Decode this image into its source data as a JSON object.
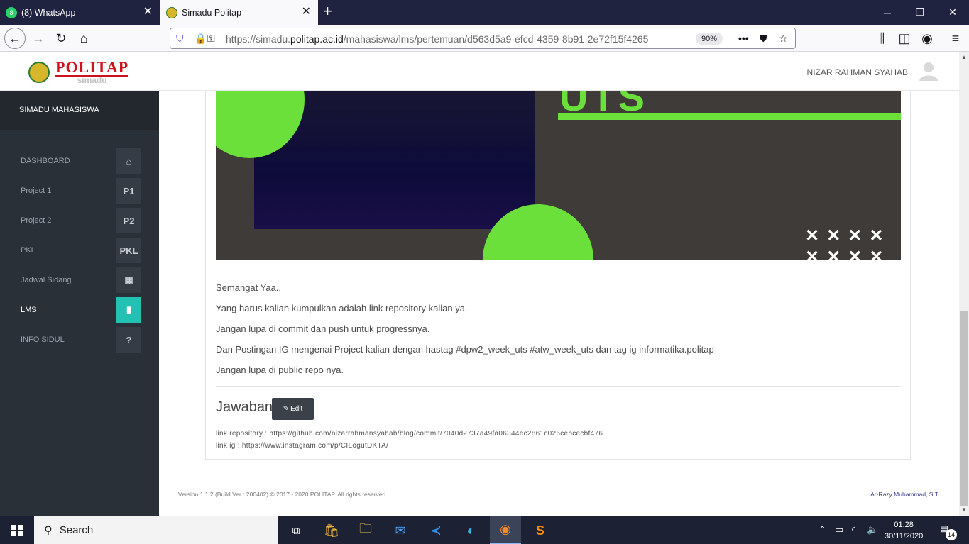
{
  "browser": {
    "tabs": [
      {
        "title": "(8) WhatsApp",
        "badge": "8",
        "active": false
      },
      {
        "title": "Simadu Politap",
        "active": true
      }
    ],
    "url_prefix": "https://simadu.",
    "url_domain": "politap.ac.id",
    "url_path": "/mahasiswa/lms/pertemuan/d563d5a9-efcd-4359-8b91-2e72f15f4265",
    "zoom": "90%"
  },
  "app": {
    "logo_title": "POLITAP",
    "logo_sub": "simadu",
    "username": "NIZAR RAHMAN SYAHAB"
  },
  "sidebar": {
    "title": "SIMADU MAHASISWA",
    "items": [
      {
        "label": "DASHBOARD",
        "icon": "⌂",
        "icon_name": "home-icon"
      },
      {
        "label": "Project 1",
        "icon": "P1",
        "icon_name": "p1-icon"
      },
      {
        "label": "Project 2",
        "icon": "P2",
        "icon_name": "p2-icon"
      },
      {
        "label": "PKL",
        "icon": "PKL",
        "icon_name": "pkl-icon"
      },
      {
        "label": "Jadwal Sidang",
        "icon": "▦",
        "icon_name": "calendar-icon"
      },
      {
        "label": "LMS",
        "icon": "▮",
        "icon_name": "file-icon",
        "active": true
      },
      {
        "label": "INFO SIDUL",
        "icon": "?",
        "icon_name": "question-icon"
      }
    ]
  },
  "banner": {
    "text": "UTS"
  },
  "content": {
    "paragraphs": [
      "Semangat Yaa..",
      "Yang harus kalian kumpulkan adalah link repository kalian ya.",
      "Jangan lupa di commit dan push untuk progressnya.",
      "Dan Postingan IG mengenai Project kalian dengan hastag #dpw2_week_uts #atw_week_uts dan tag ig informatika.politap",
      "Jangan lupa di public repo nya."
    ],
    "answer_title": "Jawaban",
    "edit_label": "Edit",
    "link_repository": "link repository : https://github.com/nizarrahmansyahab/blog/commit/7040d2737a49fa06344ec2861c026cebcecbf476",
    "link_ig": "link ig : https://www.instagram.com/p/CILogutDKTA/"
  },
  "footer": {
    "left": "Version 1.1.2 (Build Ver : 200402) © 2017 - 2020 POLITAP. All rights reserved.",
    "right": "Ar-Razy Muhammad, S.T"
  },
  "taskbar": {
    "search": "Search",
    "time": "01.28",
    "date": "30/11/2020",
    "notifications": "14"
  },
  "colors": {
    "accent": "#21c2b4",
    "sidebar": "#2a3038",
    "green": "#6be03a",
    "brand_red": "#d0101a"
  }
}
